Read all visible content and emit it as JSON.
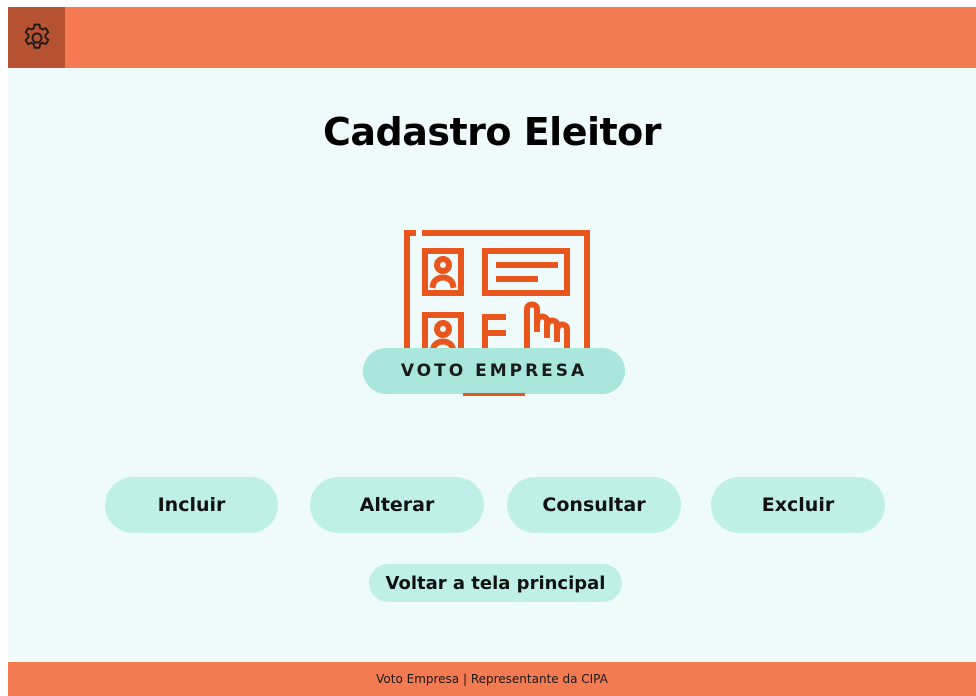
{
  "header": {
    "settings_icon": "gear-icon"
  },
  "page": {
    "title": "Cadastro Eleitor"
  },
  "logo": {
    "text": "VOTO EMPRESA",
    "icon": "ballot-form-icon",
    "color": "#e8551d"
  },
  "actions": {
    "incluir": "Incluir",
    "alterar": "Alterar",
    "consultar": "Consultar",
    "excluir": "Excluir",
    "voltar": "Voltar a tela principal"
  },
  "footer": {
    "text": "Voto Empresa | Representante da CIPA"
  },
  "colors": {
    "accent": "#f47a52",
    "accent_dark": "#b65232",
    "background": "#effafa",
    "button": "#bff0e8"
  }
}
